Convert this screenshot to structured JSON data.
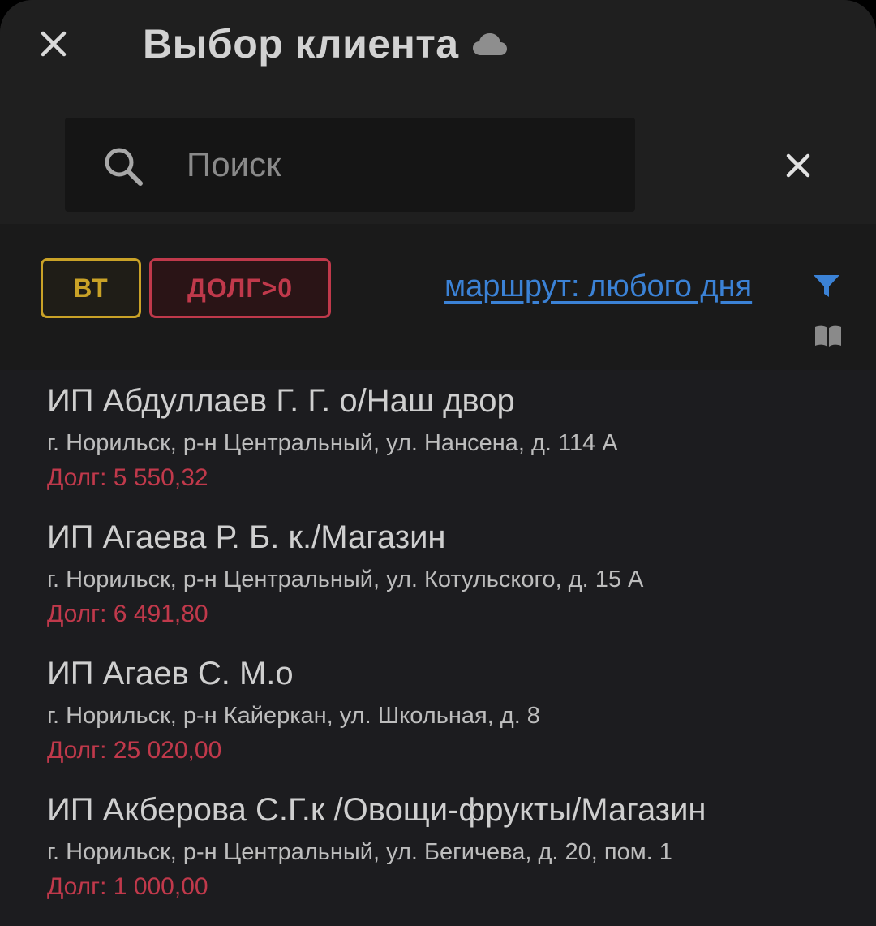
{
  "header": {
    "title": "Выбор клиента",
    "close_icon": "close-icon",
    "cloud_icon": "cloud-icon"
  },
  "search": {
    "placeholder": "Поиск",
    "value": "",
    "search_icon": "search-icon",
    "clear_icon": "close-icon"
  },
  "filters": {
    "chips": [
      {
        "label": "ВТ",
        "color": "#c9a227"
      },
      {
        "label": "ДОЛГ>0",
        "color": "#c0394b"
      }
    ],
    "route_label": "маршрут: любого дня ",
    "route_color": "#3b82d6",
    "filter_icon": "filter-funnel-icon"
  },
  "clients": [
    {
      "name": "ИП Абдуллаев Г. Г. о/Наш двор",
      "address": "г. Норильск, р-н Центральный, ул. Нансена, д. 114 А",
      "debt": "Долг: 5 550,32"
    },
    {
      "name": "ИП Агаева Р. Б. к./Магазин",
      "address": "г. Норильск, р-н Центральный, ул. Котульского, д. 15 А",
      "debt": "Долг: 6 491,80"
    },
    {
      "name": "ИП Агаев С. М.о",
      "address": "г. Норильск, р-н Кайеркан, ул. Школьная, д. 8",
      "debt": "Долг: 25 020,00",
      "icon": "book-icon"
    },
    {
      "name": "ИП Акберова С.Г.к /Овощи-фрукты/Магазин",
      "address": "г. Норильск, р-н Центральный, ул. Бегичева, д. 20, пом. 1",
      "debt": "Долг: 1 000,00"
    }
  ],
  "colors": {
    "background": "#1c1c1f",
    "header_bg": "#1f1f1f",
    "debt_text": "#c0394b",
    "link": "#3b82d6",
    "accent_yellow": "#c9a227"
  }
}
